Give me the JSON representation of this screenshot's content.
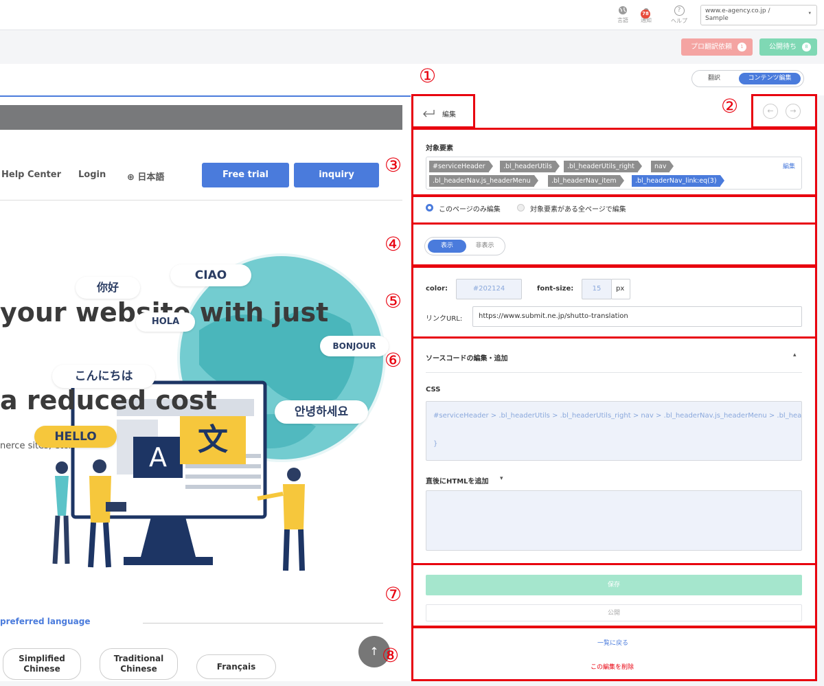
{
  "topbar": {
    "language": "言語",
    "notifications": "通知",
    "notification_count": "78",
    "help": "ヘルプ",
    "help_glyph": "?",
    "site_line1": "www.e-agency.co.jp /",
    "site_line2": "Sample",
    "site_caret": "▾"
  },
  "requests": {
    "pro_label": "プロ翻訳依頼",
    "pro_count": "1",
    "pending_label": "公開待ち",
    "pending_count": "8"
  },
  "mode": {
    "translate": "翻訳",
    "content_edit": "コンテンツ編集"
  },
  "preview": {
    "nav": {
      "help_center": "Help Center",
      "login": "Login",
      "language": "⊕ 日本語",
      "free_trial": "Free trial",
      "inquiry": "inquiry"
    },
    "hero_line1": "your website with just",
    "hero_line2": "a reduced cost",
    "hero_sub": "nerce sites, etc.",
    "bubbles": {
      "nihao": "你好",
      "ciao": "CIAO",
      "hola": "HOLA",
      "bonjour": "BONJOUR",
      "konnichiwa": "こんにちは",
      "annyeong": "안녕하세요",
      "hello": "HELLO"
    },
    "sign_a": "A",
    "sign_bun": "文",
    "preferred_language": "preferred language",
    "languages": [
      "Simplified Chinese",
      "Traditional Chinese",
      "Français"
    ],
    "scroll_top": "↑"
  },
  "panel": {
    "edit_title": "編集",
    "back_glyph": "←",
    "forward_glyph": "→",
    "target_label": "対象要素",
    "selectors": [
      "#serviceHeader",
      ".bl_headerUtils",
      ".bl_headerUtils_right",
      "nav",
      ".bl_headerNav.js_headerMenu",
      ".bl_headerNav_item",
      ".bl_headerNav_link:eq(3)"
    ],
    "edit_link": "編集",
    "scope_this_page": "このページのみ編集",
    "scope_all_pages": "対象要素がある全ページで編集",
    "show": "表示",
    "hide": "非表示",
    "color_label": "color:",
    "color_value": "#202124",
    "font_size_label": "font-size:",
    "font_size_value": "15",
    "font_unit": "px",
    "link_url_label": "リンクURL:",
    "link_url_value": "https://www.submit.ne.jp/shutto-translation",
    "source_title": "ソースコードの編集・追加",
    "source_caret": "▴",
    "css_label": "CSS",
    "css_line1": "#serviceHeader > .bl_headerUtils > .bl_headerUtils_right > nav > .bl_headerNav.js_headerMenu > .bl_heac",
    "css_line2": "}",
    "html_after_label": "直後にHTMLを追加",
    "html_caret": "▾",
    "save": "保存",
    "publish": "公開",
    "back_to_list": "一覧に戻る",
    "delete_edit": "この編集を削除"
  },
  "annotations": [
    "①",
    "②",
    "③",
    "④",
    "⑤",
    "⑥",
    "⑦",
    "⑧"
  ],
  "colors": {
    "accent": "#4a7bdc",
    "annotation_red": "#e8000e",
    "save_green": "#a5e6cd",
    "pro_btn": "#f4a4a2",
    "pending_btn": "#7fd8b4"
  }
}
